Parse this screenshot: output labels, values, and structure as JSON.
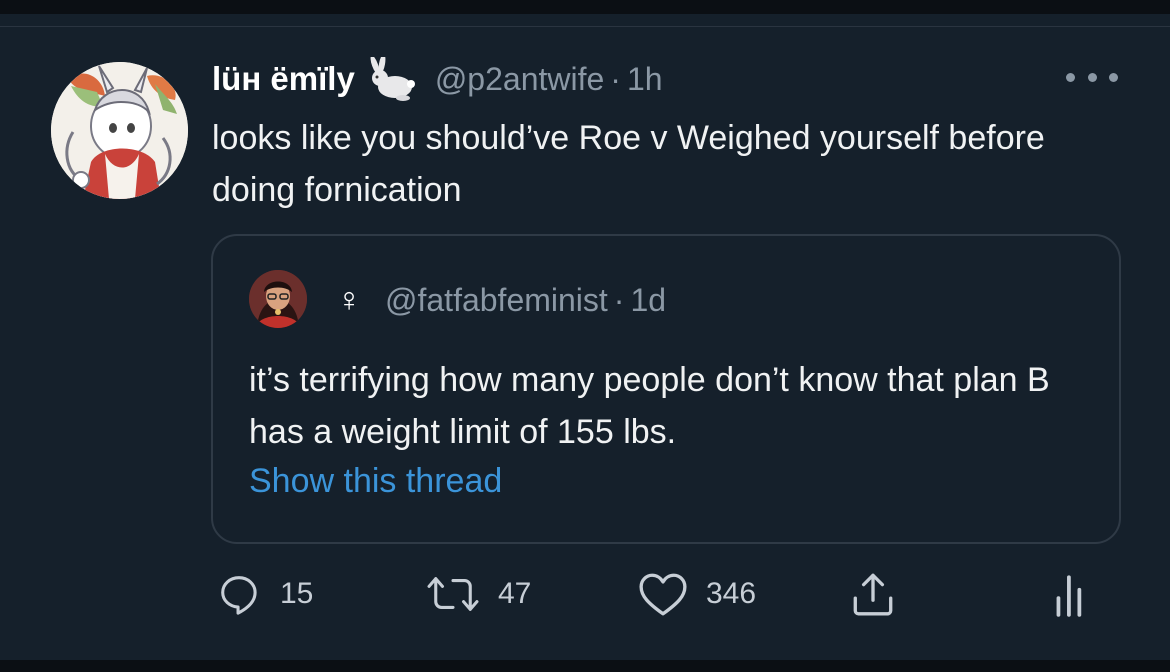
{
  "tweet": {
    "display_name": "lüн ëmïly",
    "handle": "@p2antwife",
    "separator": "·",
    "time": "1h",
    "text": "looks like you should’ve Roe v Weighed yourself before doing fornication"
  },
  "quoted_tweet": {
    "display_name": "♀",
    "handle": "@fatfabfeminist",
    "separator": "·",
    "time": "1d",
    "text": "it’s terrifying how many people don’t know that plan B has a weight limit of 155 lbs.",
    "show_thread_label": "Show this thread"
  },
  "actions": {
    "reply_count": "15",
    "retweet_count": "47",
    "like_count": "346"
  },
  "icons": {
    "name_emoji": "rabbit-icon",
    "more": "more-icon",
    "reply": "reply-icon",
    "retweet": "retweet-icon",
    "like": "heart-icon",
    "share": "share-icon",
    "analytics": "analytics-icon"
  },
  "colors": {
    "background": "#15202b",
    "link": "#3b94d9",
    "secondary_text": "#8b98a5"
  }
}
